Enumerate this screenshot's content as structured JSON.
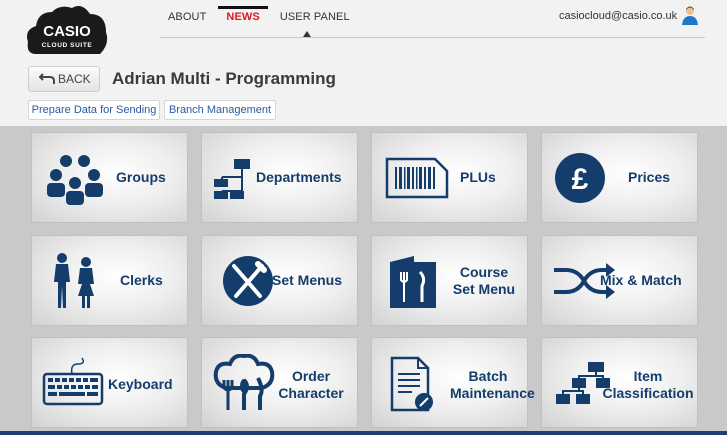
{
  "brand": {
    "name": "CASIO",
    "sub": "CLOUD SUITE"
  },
  "nav": {
    "items": [
      "ABOUT",
      "NEWS",
      "USER PANEL"
    ]
  },
  "user": {
    "email": "casiocloud@casio.co.uk"
  },
  "page": {
    "back_label": "BACK",
    "title": "Adrian Multi - Programming"
  },
  "actions": {
    "prepare": "Prepare Data for Sending",
    "branch": "Branch Management"
  },
  "tiles": [
    {
      "label": "Groups",
      "icon": "groups-icon"
    },
    {
      "label": "Departments",
      "icon": "departments-icon"
    },
    {
      "label": "PLUs",
      "icon": "barcode-icon"
    },
    {
      "label": "Prices",
      "icon": "pound-icon"
    },
    {
      "label": "Clerks",
      "icon": "clerks-icon"
    },
    {
      "label": "Set Menus",
      "icon": "cutlery-icon"
    },
    {
      "label": "Course Set Menu",
      "line1": "Course",
      "line2": "Set Menu",
      "icon": "menu-book-icon"
    },
    {
      "label": "Mix & Match",
      "icon": "shuffle-icon"
    },
    {
      "label": "Keyboard",
      "icon": "keyboard-icon"
    },
    {
      "label": "Order Character",
      "line1": "Order",
      "line2": "Character",
      "icon": "chef-icon"
    },
    {
      "label": "Batch Maintenance",
      "line1": "Batch",
      "line2": "Maintenance",
      "icon": "document-icon"
    },
    {
      "label": "Item Classification",
      "line1": "Item",
      "line2": "Classification",
      "icon": "hierarchy-icon"
    }
  ],
  "colors": {
    "accent": "#143d6b",
    "news": "#d71920",
    "strip": "#1d3f73"
  }
}
